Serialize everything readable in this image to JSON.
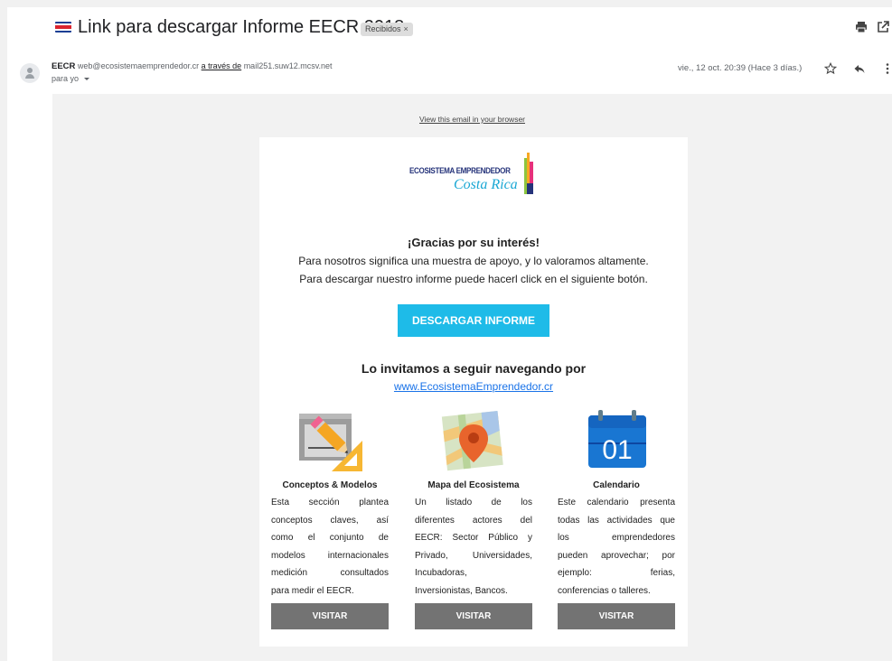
{
  "email": {
    "subject": "Link para descargar Informe EECR 2018",
    "label": "Recibidos",
    "label_close": "×",
    "sender_name": "EECR",
    "sender_email": "web@ecosistemaemprendedor.cr",
    "via_text": "a través de",
    "via_domain": "mail251.suw12.mcsv.net",
    "to_text": "para yo",
    "date": "vie., 12 oct. 20:39 (Hace 3 días.)"
  },
  "body": {
    "view_browser": "View this email in your browser",
    "logo_line1": "ECOSISTEMA EMPRENDEDOR",
    "logo_line2": "Costa Rica",
    "thanks": "¡Gracias por su interés!",
    "para1": "Para nosotros significa una muestra de apoyo, y lo valoramos altamente.",
    "para2": "Para descargar nuestro informe puede hacerl click en el siguiente botón.",
    "download_button": "DESCARGAR INFORME",
    "invite": "Lo invitamos a seguir navegando por",
    "site_link": "www.EcosistemaEmprendedor.cr"
  },
  "columns": [
    {
      "title": "Conceptos & Modelos",
      "lines": [
        "Esta sección plantea",
        "conceptos claves, así",
        "como el conjunto de",
        "modelos internacionales",
        "medición consultados",
        "para medir el EECR."
      ],
      "button": "VISITAR",
      "icon": "pencil-ruler-icon"
    },
    {
      "title": "Mapa del Ecosistema",
      "lines": [
        "Un listado de los",
        "diferentes actores del",
        "EECR: Sector Público y",
        "Privado, Universidades,",
        "Incubadoras,",
        "Inversionistas, Bancos."
      ],
      "button": "VISITAR",
      "icon": "map-pin-icon"
    },
    {
      "title": "Calendario",
      "calendar_number": "01",
      "lines": [
        "Este calendario presenta",
        "todas las actividades que",
        "los emprendedores",
        "pueden aprovechar; por",
        "ejemplo: ferias,",
        "conferencias o talleres."
      ],
      "button": "VISITAR",
      "icon": "calendar-icon"
    }
  ],
  "colors": {
    "download_button": "#1ebbe8",
    "visit_button": "#737373",
    "link": "#1a73e8",
    "logo_navy": "#25337a",
    "logo_cyan": "#1aa7d4"
  }
}
